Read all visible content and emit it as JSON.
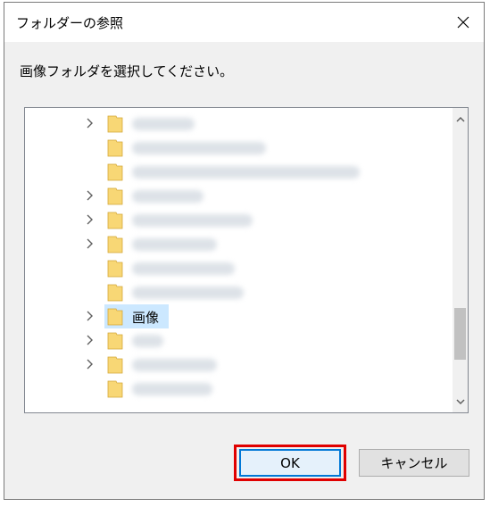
{
  "dialog": {
    "title": "フォルダーの参照",
    "instruction": "画像フォルダを選択してください。"
  },
  "tree": {
    "selected_folder": "画像",
    "rows": [
      {
        "expandable": true
      },
      {
        "expandable": false
      },
      {
        "expandable": false
      },
      {
        "expandable": true
      },
      {
        "expandable": true
      },
      {
        "expandable": true
      },
      {
        "expandable": false
      },
      {
        "expandable": false
      },
      {
        "expandable": true,
        "label": "画像",
        "selected": true
      },
      {
        "expandable": true
      },
      {
        "expandable": true
      },
      {
        "expandable": false
      }
    ]
  },
  "buttons": {
    "ok": "OK",
    "cancel": "キャンセル"
  },
  "colors": {
    "highlight_frame": "#e00000",
    "selection": "#cce8ff",
    "folder": "#f8d775"
  },
  "icons": {
    "close": "close-icon",
    "folder": "folder-icon",
    "expand": "chevron-right-icon",
    "scroll_up": "chevron-up-icon",
    "scroll_down": "chevron-down-icon"
  }
}
